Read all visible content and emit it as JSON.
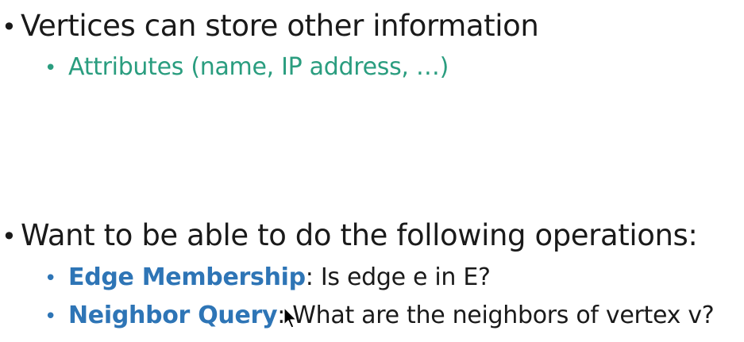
{
  "slide": {
    "bullet1": {
      "marker": "•",
      "text": "Vertices can store other information",
      "sub1": {
        "marker": "•",
        "text": "Attributes (name, IP address, …)"
      }
    },
    "bullet2": {
      "marker": "•",
      "text": "Want to be able to do the following operations:",
      "sub1": {
        "marker": "•",
        "term": "Edge Membership",
        "rest": ": Is edge e in E?"
      },
      "sub2": {
        "marker": "•",
        "term": "Neighbor Query",
        "rest": ": What are the neighbors of vertex v?"
      }
    }
  },
  "colors": {
    "teal": "#2a9d7f",
    "blue": "#2e75b6",
    "text": "#1a1a1a"
  }
}
